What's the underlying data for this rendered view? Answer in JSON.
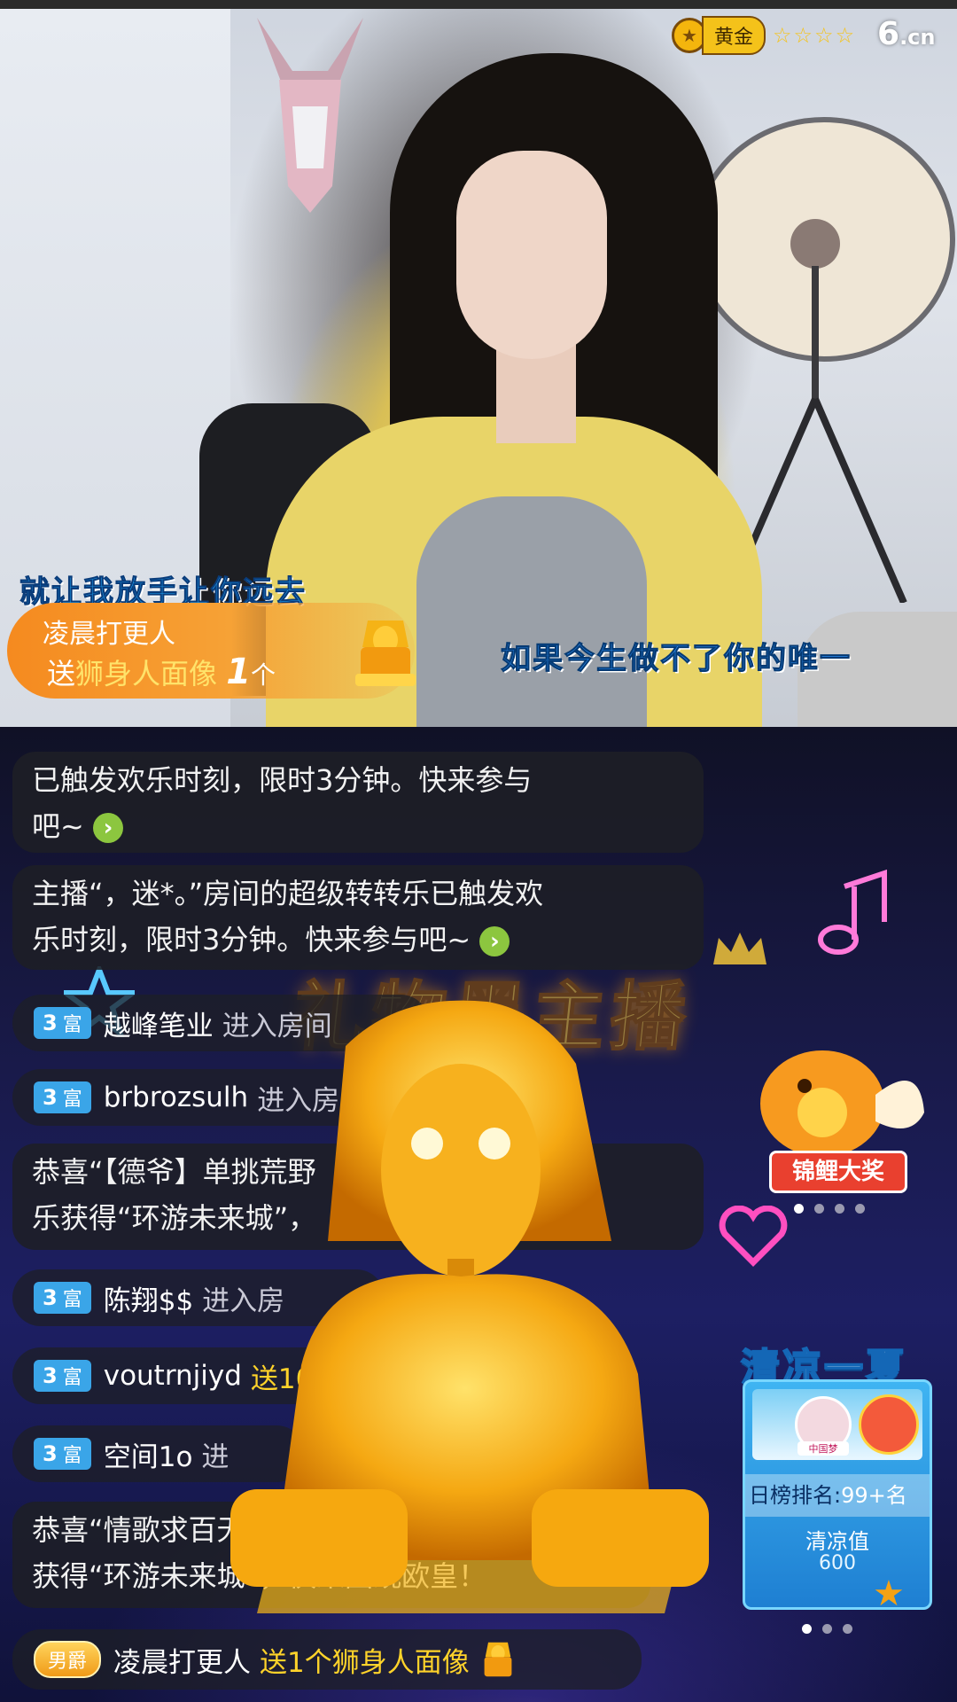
{
  "header": {
    "tier_label": "黄金",
    "stars": "☆☆☆☆",
    "site_logo": "6",
    "site_logo_suffix": ".cn"
  },
  "video": {
    "lyric_left": "就让我放手让你远去",
    "lyric_right": "如果今生做不了你的唯一",
    "gift_notice": {
      "sender": "凌晨打更人",
      "send_word": "送",
      "gift_name": "狮身人面像",
      "count": "1",
      "unit": "个"
    }
  },
  "banner": {
    "title": "礼物墨主播"
  },
  "chat": {
    "system_msgs": [
      {
        "text_line1": "已触发欢乐时刻，限时3分钟。快来参与",
        "text_line2": "吧~"
      },
      {
        "text_line1": "主播“，迷*。”房间的超级转转乐已触发欢",
        "text_line2": "乐时刻，限时3分钟。快来参与吧~"
      },
      {
        "text_line1": "恭喜“【德爷】单挑荒野",
        "text_line1b": "转转",
        "text_line2": "乐获得“环游未来城”，",
        "text_line2b": "！"
      },
      {
        "text_line1": "恭喜“情歌求百无",
        "text_line2": "获得“环游未来城”，快来围观欧皇！"
      }
    ],
    "user_rows": [
      {
        "level": "3",
        "badge": "富",
        "name": "越峰笔业",
        "action": "进入房间"
      },
      {
        "level": "3",
        "badge": "富",
        "name": "brbrozsulh",
        "action": "进入房"
      },
      {
        "level": "3",
        "badge": "富",
        "name": "陈翔$$",
        "action": "进入房"
      },
      {
        "level": "3",
        "badge": "富",
        "name": "voutrnjiyd",
        "action": "送10"
      },
      {
        "level": "3",
        "badge": "富",
        "name": "空间1o",
        "action": "进"
      }
    ],
    "last_row": {
      "badge": "男爵",
      "name": "凌晨打更人",
      "action": "送1个狮身人面像"
    }
  },
  "side": {
    "koi_label": "锦鲤大奖",
    "summer_title": "清凉一夏",
    "avatar_caption": "中国梦",
    "rank_label": "日榜排名:",
    "rank_value": "99+名",
    "value_label": "清凉值",
    "value": "600"
  },
  "colors": {
    "accent_orange": "#f58a1f",
    "rich_badge": "#3aa5e8",
    "gold_text": "#ffd32a",
    "arrow_green": "#8cc63f"
  }
}
